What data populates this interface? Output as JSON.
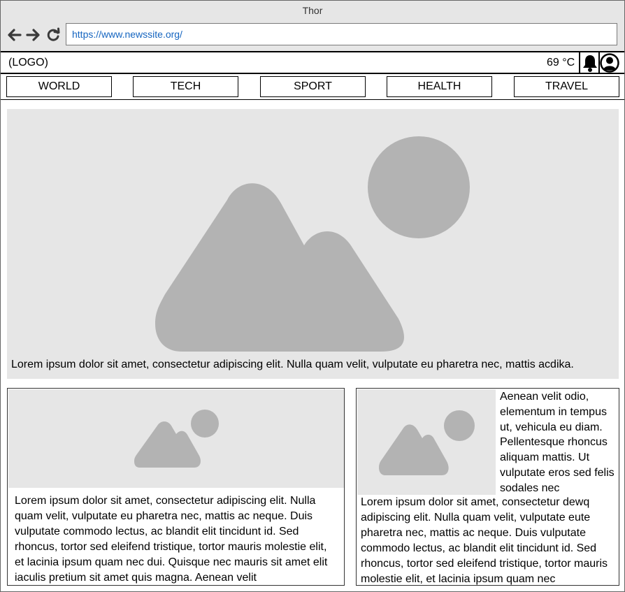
{
  "window": {
    "title": "Thor"
  },
  "browser": {
    "url": "https://www.newssite.org/"
  },
  "header": {
    "logo": "(LOGO)",
    "weather": "69 °C"
  },
  "nav": {
    "categories": [
      {
        "label": "WORLD"
      },
      {
        "label": "TECH"
      },
      {
        "label": "SPORT"
      },
      {
        "label": "HEALTH"
      },
      {
        "label": "TRAVEL"
      }
    ]
  },
  "hero": {
    "caption": "Lorem ipsum dolor sit amet, consectetur adipiscing elit. Nulla quam velit, vulputate eu pharetra nec, mattis acdika."
  },
  "articles": [
    {
      "text": "Lorem ipsum dolor sit amet, consectetur adipiscing elit. Nulla quam velit, vulputate eu pharetra nec, mattis ac neque. Duis vulputate commodo lectus, ac blandit elit tincidunt id. Sed rhoncus, tortor sed eleifend tristique, tortor mauris molestie elit, et lacinia ipsum quam nec dui. Quisque nec mauris sit amet elit iaculis pretium sit amet quis magna. Aenean velit"
    },
    {
      "side_text": "Aenean velit odio, elementum in tempus ut, vehicula eu diam. Pellentesque rhoncus aliquam mattis. Ut vulputate eros sed felis sodales nec",
      "text": "Lorem ipsum dolor sit amet, consectetur dewq adipiscing elit. Nulla quam velit, vulputate eute pharetra nec, mattis ac neque. Duis vulputate commodo lectus, ac blandit elit tincidunt id. Sed rhoncus, tortor sed eleifend tristique, tortor mauris molestie elit, et lacinia ipsum quam nec"
    }
  ],
  "colors": {
    "placeholder_bg": "#e6e6e6",
    "placeholder_shape": "#b3b3b3",
    "url_text": "#1565c0",
    "chrome": "#e6e6e6"
  },
  "icons": {
    "back": "arrow-left-icon",
    "forward": "arrow-right-icon",
    "reload": "reload-icon",
    "notifications": "bell-icon",
    "account": "user-circle-icon",
    "image_placeholder": "image-icon"
  }
}
